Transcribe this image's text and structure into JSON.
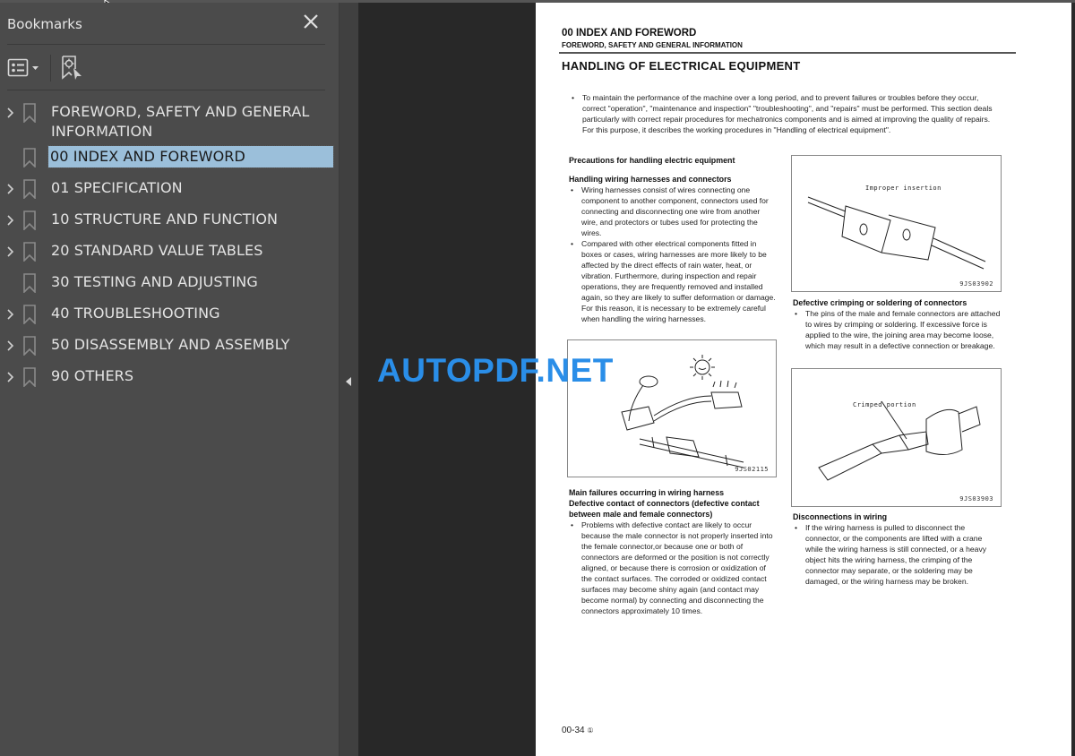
{
  "sidebar": {
    "title": "Bookmarks",
    "close_icon": "close-icon",
    "toolbar": {
      "options_icon": "list-options-icon",
      "find_icon": "find-current-bookmark-icon"
    },
    "items": [
      {
        "label": "FOREWORD, SAFETY AND GENERAL INFORMATION",
        "expandable": true,
        "selected": false
      },
      {
        "label": "00 INDEX AND FOREWORD",
        "expandable": false,
        "selected": true
      },
      {
        "label": "01 SPECIFICATION",
        "expandable": true,
        "selected": false
      },
      {
        "label": "10 STRUCTURE AND FUNCTION",
        "expandable": true,
        "selected": false
      },
      {
        "label": "20 STANDARD VALUE TABLES",
        "expandable": true,
        "selected": false
      },
      {
        "label": "30 TESTING AND ADJUSTING",
        "expandable": false,
        "selected": false
      },
      {
        "label": "40 TROUBLESHOOTING",
        "expandable": true,
        "selected": false
      },
      {
        "label": "50 DISASSEMBLY AND ASSEMBLY",
        "expandable": true,
        "selected": false
      },
      {
        "label": "90 OTHERS",
        "expandable": true,
        "selected": false
      }
    ]
  },
  "page": {
    "section": "00 INDEX AND FOREWORD",
    "subsection": "FOREWORD, SAFETY AND GENERAL INFORMATION",
    "title": "HANDLING OF ELECTRICAL EQUIPMENT",
    "intro": "To maintain the performance of the machine over a long period, and to prevent failures or troubles before they occur, correct \"operation\", \"maintenance and inspection\" \"troubleshooting\", and \"repairs\" must be performed. This section deals particularly with correct repair procedures for mechatronics components and is aimed at improving the quality of repairs. For this purpose, it describes the working procedures in \"Handling of electrical equipment\".",
    "left": {
      "heading1": "Precautions for handling electric equipment",
      "heading2": "Handling wiring harnesses and connectors",
      "bullet1": "Wiring harnesses consist of wires connecting one component to another component, connectors used for connecting and disconnecting one wire from another wire, and protectors or tubes used for protecting the wires.",
      "bullet2": "Compared with other electrical components fitted in boxes or cases, wiring harnesses are more likely to be affected by the direct effects of rain water, heat, or vibration. Furthermore, during inspection and repair operations, they are frequently removed and installed again, so they are likely to suffer deformation or damage. For this reason, it is necessary to be extremely careful when handling the wiring harnesses.",
      "figure_code": "9JS02115",
      "heading3": "Main failures occurring in wiring harness",
      "heading4": "Defective contact of connectors (defective contact between male and female connectors)",
      "bullet3": "Problems with defective contact are likely to occur because the male connector is not properly inserted into the female connector,or because one or both of connectors are deformed or the position is not correctly aligned, or because there is corrosion or oxidization of the contact surfaces. The corroded or oxidized contact surfaces may become shiny again (and contact may become normal) by connecting and disconnecting the connectors approximately 10 times."
    },
    "right": {
      "figure1_caption": "Improper insertion",
      "figure1_code": "9JS03902",
      "heading1": "Defective crimping or soldering of connectors",
      "bullet1": "The pins of the male and female connectors are attached to wires by crimping or soldering. If excessive force is applied to the wire, the joining area may become loose, which may result in a defective connection or breakage.",
      "figure2_caption": "Crimped portion",
      "figure2_code": "9JS03903",
      "heading2": "Disconnections in wiring",
      "bullet2": "If the wiring harness is pulled to disconnect the connector, or the components are lifted with a crane while the wiring harness is still connected, or a heavy object hits the wiring harness, the crimping of the connector may separate, or the soldering may be damaged, or the wiring harness may be broken."
    },
    "footer": "00-34",
    "footer_mark": "①"
  },
  "watermark": "AUTOPDF.NET",
  "colors": {
    "sidebar_bg": "#4b4b4b",
    "canvas_bg": "#282828",
    "selection": "#9bbfda",
    "watermark": "#2a8ee8"
  }
}
